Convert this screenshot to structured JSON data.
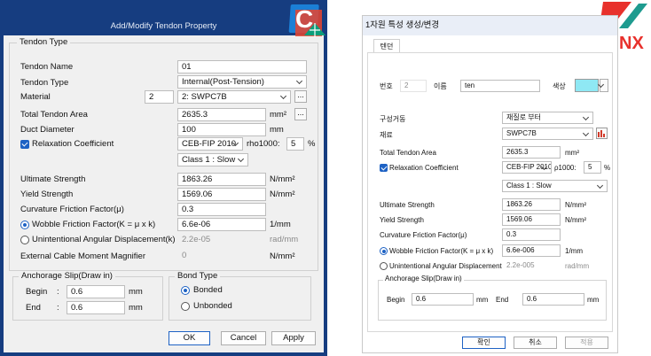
{
  "left": {
    "title": "Add/Modify Tendon Property",
    "tendon_type_group": "Tendon Type",
    "tendon_name_label": "Tendon Name",
    "tendon_name": "01",
    "tendon_type_label": "Tendon Type",
    "tendon_type": "Internal(Post-Tension)",
    "material_label": "Material",
    "material_no": "2",
    "material": "2: SWPC7B",
    "total_area_label": "Total Tendon Area",
    "total_area": "2635.3",
    "total_area_unit": "mm²",
    "duct_label": "Duct Diameter",
    "duct": "100",
    "duct_unit": "mm",
    "relax_label": "Relaxation Coefficient",
    "relax_model": "CEB-FIP 2010",
    "rho_label": "rho1000:",
    "rho_value": "5",
    "rho_unit": "%",
    "relax_class": "Class 1 : Slow",
    "ultimate_label": "Ultimate Strength",
    "ultimate": "1863.26",
    "ultimate_unit": "N/mm²",
    "yield_label": "Yield Strength",
    "yield": "1569.06",
    "yield_unit": "N/mm²",
    "curv_label": "Curvature Friction Factor(μ)",
    "curv": "0.3",
    "wobble_label": "Wobble Friction Factor(K = μ x k)",
    "wobble": "6.6e-06",
    "wobble_unit": "1/mm",
    "unint_label": "Unintentional Angular Displacement(k)",
    "unint": "2.2e-05",
    "unint_unit": "rad/mm",
    "ext_label": "External Cable Moment Magnifier",
    "ext": "0",
    "ext_unit": "N/mm²",
    "anchor_group": "Anchorage Slip(Draw in)",
    "begin_label": "Begin",
    "begin": "0.6",
    "end_label": "End",
    "end": "0.6",
    "mm": "mm",
    "colon": ":",
    "bond_group": "Bond Type",
    "bonded": "Bonded",
    "unbonded": "Unbonded",
    "ok": "OK",
    "cancel": "Cancel",
    "apply": "Apply",
    "ellipsis": "..."
  },
  "right": {
    "title": "1자원 특성 생성/변경",
    "tab": "텐던",
    "no_label": "번호",
    "no_value": "2",
    "name_label": "이름",
    "name_value": "ten",
    "color_label": "색상",
    "composition_label": "구성거동",
    "composition": "재질로 부터",
    "material_label": "재료",
    "material": "SWPC7B",
    "area_label": "Total Tendon Area",
    "area": "2635.3",
    "area_unit": "mm²",
    "relax_label": "Relaxation Coefficient",
    "relax_model": "CEB-FIP 2010",
    "rho_label": "ρ1000:",
    "rho": "5",
    "rho_unit": "%",
    "relax_class": "Class 1 : Slow",
    "ultimate_label": "Ultimate Strength",
    "ultimate": "1863.26",
    "ultimate_unit": "N/mm²",
    "yield_label": "Yield Strength",
    "yield": "1569.06",
    "yield_unit": "N/mm²",
    "curv_label": "Curvature Friction Factor(μ)",
    "curv": "0.3",
    "wobble_label": "Wobble Friction Factor(K = μ x k)",
    "wobble": "6.6e-006",
    "wobble_unit": "1/mm",
    "unint_label": "Unintentional Angular Displacement(k)",
    "unint": "2.2e-005",
    "unint_unit": "rad/mm",
    "anchor_group": "Anchorage Slip(Draw in)",
    "begin_label": "Begin",
    "begin": "0.6",
    "end_label": "End",
    "end": "0.6",
    "mm": "mm",
    "ok": "확인",
    "cancel": "취소",
    "apply": "적용"
  },
  "logos": {
    "civil": "C",
    "nx": "NX"
  },
  "colors": {
    "title_bar": "#163d80",
    "accent": "#1e62c4",
    "swatch": "#8fe8f4",
    "nx_red": "#e8312c"
  }
}
